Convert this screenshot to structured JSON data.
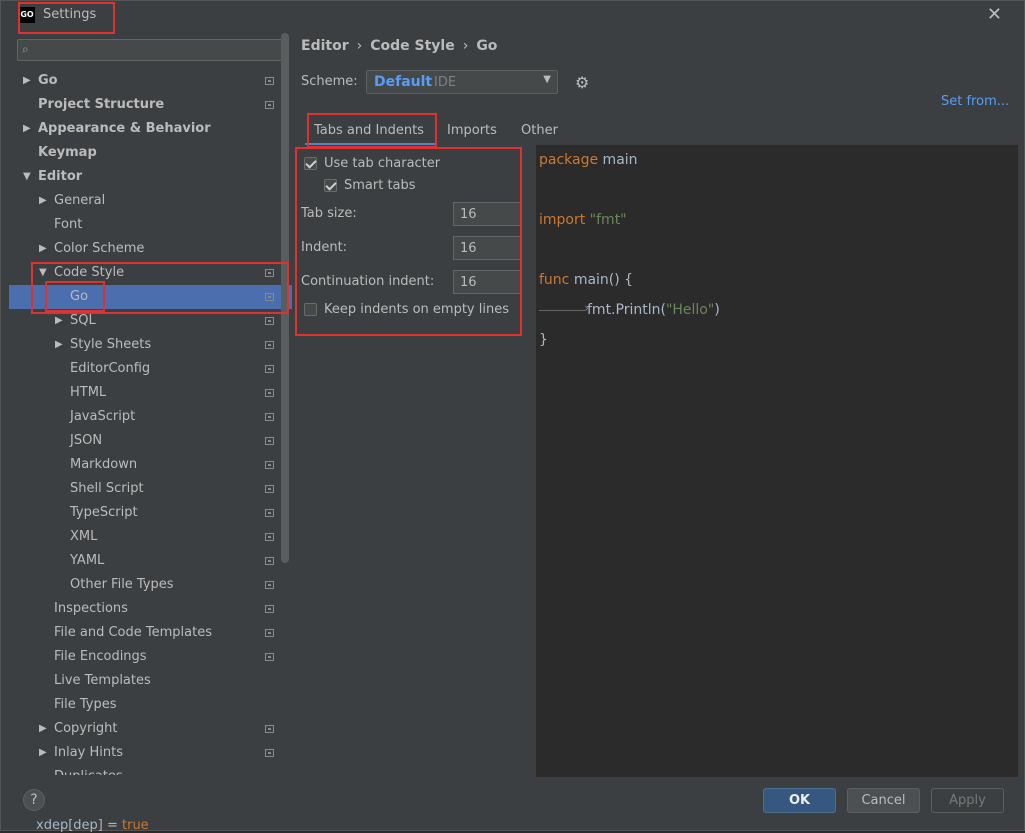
{
  "window": {
    "title": "Settings",
    "app_icon": "GO",
    "close_icon": "close-icon"
  },
  "search": {
    "placeholder": "",
    "value": ""
  },
  "sidebar": {
    "items": [
      {
        "label": "Go",
        "depth": 0,
        "arrow": "▶",
        "bold": true,
        "icon": true
      },
      {
        "label": "Project Structure",
        "depth": 0,
        "arrow": "",
        "bold": true,
        "icon": true
      },
      {
        "label": "Appearance & Behavior",
        "depth": 0,
        "arrow": "▶",
        "bold": true,
        "icon": false
      },
      {
        "label": "Keymap",
        "depth": 0,
        "arrow": "",
        "bold": true,
        "icon": false
      },
      {
        "label": "Editor",
        "depth": 0,
        "arrow": "▼",
        "bold": true,
        "icon": false
      },
      {
        "label": "General",
        "depth": 1,
        "arrow": "▶",
        "bold": false,
        "icon": false
      },
      {
        "label": "Font",
        "depth": 1,
        "arrow": "",
        "bold": false,
        "icon": false
      },
      {
        "label": "Color Scheme",
        "depth": 1,
        "arrow": "▶",
        "bold": false,
        "icon": false
      },
      {
        "label": "Code Style",
        "depth": 1,
        "arrow": "▼",
        "bold": false,
        "icon": true
      },
      {
        "label": "Go",
        "depth": 2,
        "arrow": "",
        "bold": false,
        "icon": true,
        "selected": true
      },
      {
        "label": "SQL",
        "depth": 2,
        "arrow": "▶",
        "bold": false,
        "icon": true
      },
      {
        "label": "Style Sheets",
        "depth": 2,
        "arrow": "▶",
        "bold": false,
        "icon": true
      },
      {
        "label": "EditorConfig",
        "depth": 2,
        "arrow": "",
        "bold": false,
        "icon": true
      },
      {
        "label": "HTML",
        "depth": 2,
        "arrow": "",
        "bold": false,
        "icon": true
      },
      {
        "label": "JavaScript",
        "depth": 2,
        "arrow": "",
        "bold": false,
        "icon": true
      },
      {
        "label": "JSON",
        "depth": 2,
        "arrow": "",
        "bold": false,
        "icon": true
      },
      {
        "label": "Markdown",
        "depth": 2,
        "arrow": "",
        "bold": false,
        "icon": true
      },
      {
        "label": "Shell Script",
        "depth": 2,
        "arrow": "",
        "bold": false,
        "icon": true
      },
      {
        "label": "TypeScript",
        "depth": 2,
        "arrow": "",
        "bold": false,
        "icon": true
      },
      {
        "label": "XML",
        "depth": 2,
        "arrow": "",
        "bold": false,
        "icon": true
      },
      {
        "label": "YAML",
        "depth": 2,
        "arrow": "",
        "bold": false,
        "icon": true
      },
      {
        "label": "Other File Types",
        "depth": 2,
        "arrow": "",
        "bold": false,
        "icon": true
      },
      {
        "label": "Inspections",
        "depth": 1,
        "arrow": "",
        "bold": false,
        "icon": true
      },
      {
        "label": "File and Code Templates",
        "depth": 1,
        "arrow": "",
        "bold": false,
        "icon": true
      },
      {
        "label": "File Encodings",
        "depth": 1,
        "arrow": "",
        "bold": false,
        "icon": true
      },
      {
        "label": "Live Templates",
        "depth": 1,
        "arrow": "",
        "bold": false,
        "icon": false
      },
      {
        "label": "File Types",
        "depth": 1,
        "arrow": "",
        "bold": false,
        "icon": false
      },
      {
        "label": "Copyright",
        "depth": 1,
        "arrow": "▶",
        "bold": false,
        "icon": true
      },
      {
        "label": "Inlay Hints",
        "depth": 1,
        "arrow": "▶",
        "bold": false,
        "icon": true
      },
      {
        "label": "Duplicates",
        "depth": 1,
        "arrow": "",
        "bold": false,
        "icon": false
      }
    ]
  },
  "breadcrumb": {
    "part1": "Editor",
    "part2": "Code Style",
    "part3": "Go",
    "sep": "›"
  },
  "scheme": {
    "label": "Scheme:",
    "name": "Default",
    "scope": "IDE",
    "caret": "▼",
    "set_from": "Set from..."
  },
  "tabs": {
    "t1": "Tabs and Indents",
    "t2": "Imports",
    "t3": "Other"
  },
  "options": {
    "use_tab_char": {
      "label": "Use tab character",
      "checked": true
    },
    "smart_tabs": {
      "label": "Smart tabs",
      "checked": true
    },
    "tab_size": {
      "label": "Tab size:",
      "value": "16"
    },
    "indent": {
      "label": "Indent:",
      "value": "16"
    },
    "continuation": {
      "label": "Continuation indent:",
      "value": "16"
    },
    "keep_indents": {
      "label": "Keep indents on empty lines",
      "checked": false
    }
  },
  "code": {
    "l1_kw": "package",
    "l1_rest": " main",
    "l2_kw": "import",
    "l2_str": " \"fmt\"",
    "l3_kw": "func",
    "l3_rest": " main() {",
    "l4_pre": "fmt.Println(",
    "l4_str": "\"Hello\"",
    "l4_post": ")",
    "l5": "}"
  },
  "footer": {
    "help": "?",
    "ok": "OK",
    "cancel": "Cancel",
    "apply": "Apply"
  },
  "background": {
    "bottom_text": "xdep[dep] = ",
    "bottom_kw": "true"
  },
  "colors": {
    "accent": "#4b6eaf",
    "link": "#589df6",
    "highlight": "#e03131",
    "keyword": "#cc7832",
    "string": "#6a8759"
  }
}
